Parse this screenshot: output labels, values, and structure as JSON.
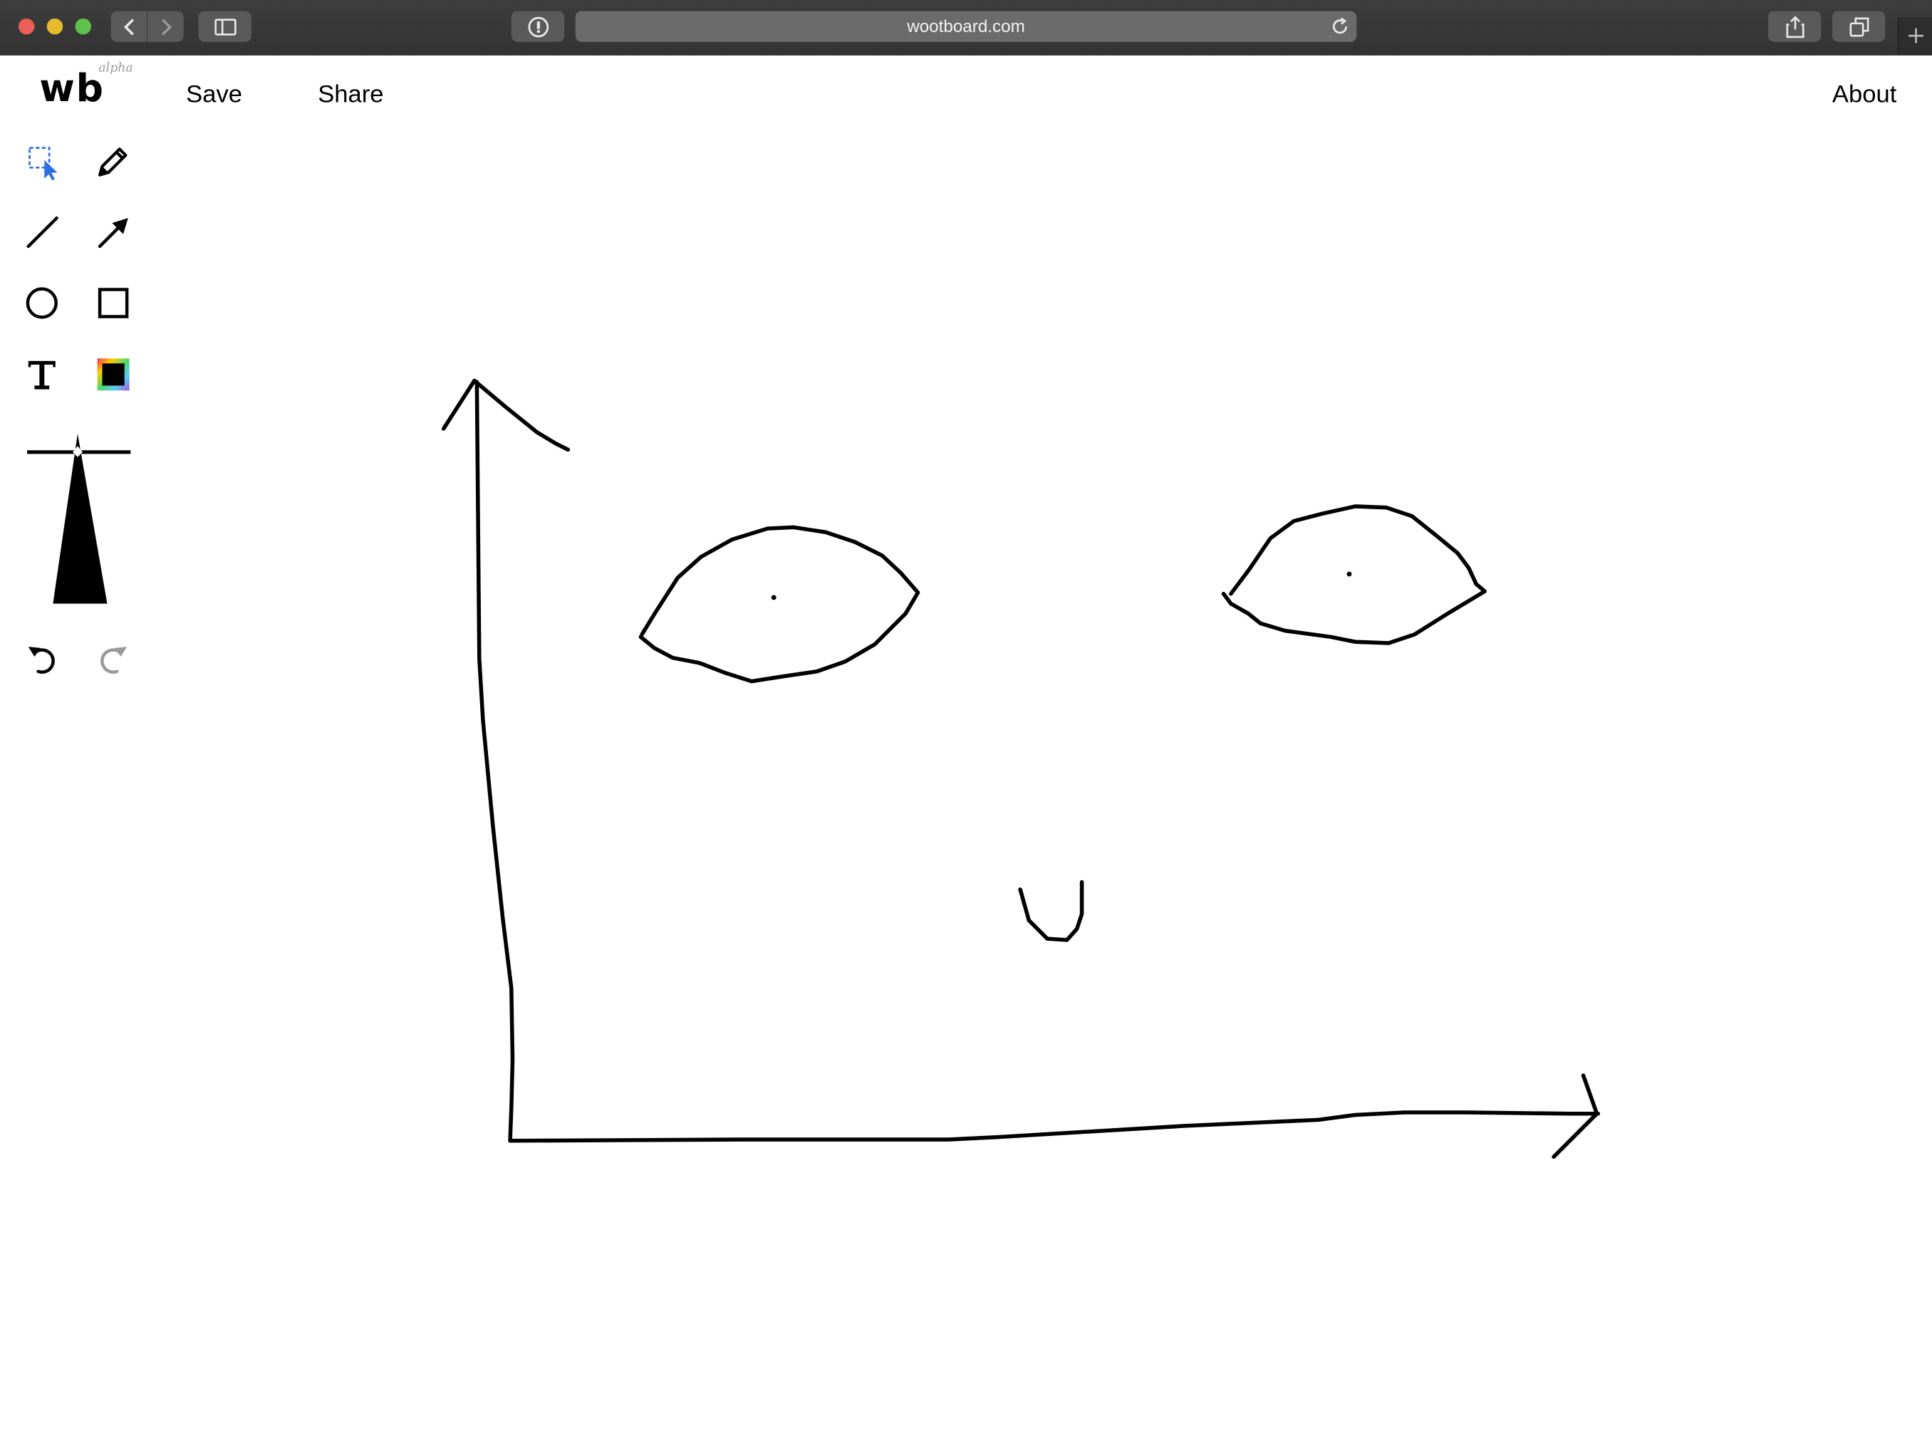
{
  "browser": {
    "url": "wootboard.com"
  },
  "app": {
    "logo": "wb",
    "logo_tag": "alpha",
    "nav": {
      "save": "Save",
      "share": "Share",
      "about": "About"
    }
  },
  "tools": [
    {
      "name": "select",
      "icon": "select-icon",
      "active": true
    },
    {
      "name": "pencil",
      "icon": "pencil-icon"
    },
    {
      "name": "line",
      "icon": "line-icon"
    },
    {
      "name": "arrow",
      "icon": "arrow-icon"
    },
    {
      "name": "circle",
      "icon": "circle-icon"
    },
    {
      "name": "rectangle",
      "icon": "rectangle-icon"
    },
    {
      "name": "text",
      "icon": "text-icon"
    },
    {
      "name": "color",
      "icon": "color-swatch-icon",
      "value": "#000000"
    },
    {
      "name": "undo",
      "icon": "undo-icon",
      "enabled": true
    },
    {
      "name": "redo",
      "icon": "redo-icon",
      "enabled": false
    }
  ],
  "colors": {
    "accent": "#2f6fe0",
    "stroke": "#000000",
    "chrome": "#383838"
  }
}
